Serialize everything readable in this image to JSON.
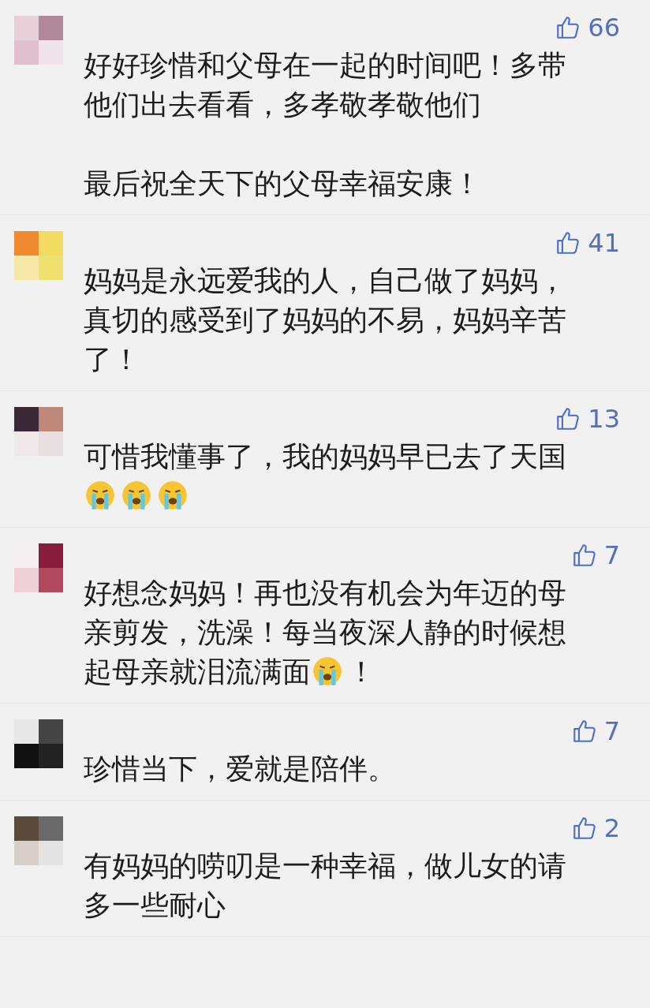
{
  "comments": [
    {
      "likes": "66",
      "paragraphs": [
        [
          {
            "kind": "text",
            "text": "好好珍惜和父母在一起的时间吧！多带他们出去看看，多孝敬孝敬他们"
          }
        ],
        [
          {
            "kind": "text",
            "text": "最后祝全天下的父母幸福安康！"
          }
        ]
      ]
    },
    {
      "likes": "41",
      "paragraphs": [
        [
          {
            "kind": "text",
            "text": "妈妈是永远爱我的人，自己做了妈妈，真切的感受到了妈妈的不易，妈妈辛苦了！"
          }
        ]
      ]
    },
    {
      "likes": "13",
      "paragraphs": [
        [
          {
            "kind": "text",
            "text": "可惜我懂事了，我的妈妈早已去了天国"
          }
        ],
        [
          {
            "kind": "emoji"
          },
          {
            "kind": "emoji"
          },
          {
            "kind": "emoji"
          }
        ]
      ]
    },
    {
      "likes": "7",
      "paragraphs": [
        [
          {
            "kind": "text",
            "text": "好想念妈妈！再也没有机会为年迈的母亲剪发，洗澡！每当夜深人静的时候想起母亲就泪流满面"
          },
          {
            "kind": "emoji"
          },
          {
            "kind": "text",
            "text": "！"
          }
        ]
      ]
    },
    {
      "likes": "7",
      "paragraphs": [
        [
          {
            "kind": "text",
            "text": "珍惜当下，爱就是陪伴。"
          }
        ]
      ]
    },
    {
      "likes": "2",
      "paragraphs": [
        [
          {
            "kind": "text",
            "text": "有妈妈的唠叨是一种幸福，做儿女的请多一些耐心"
          }
        ]
      ]
    }
  ]
}
